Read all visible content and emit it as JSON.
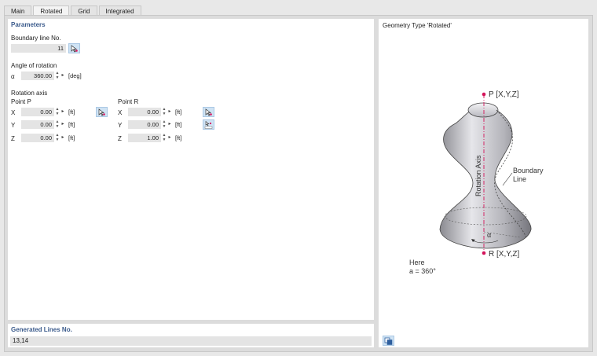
{
  "tabs": [
    "Main",
    "Rotated",
    "Grid",
    "Integrated"
  ],
  "active_tab": "Rotated",
  "parameters": {
    "title": "Parameters",
    "boundary_line_label": "Boundary line No.",
    "boundary_line_value": "11",
    "angle_label": "Angle of rotation",
    "alpha_symbol": "α",
    "alpha_value": "360.00",
    "alpha_unit": "[deg]",
    "rotation_axis_label": "Rotation axis",
    "point_p": {
      "label": "Point P",
      "x_label": "X",
      "x_value": "0.00",
      "y_label": "Y",
      "y_value": "0.00",
      "z_label": "Z",
      "z_value": "0.00",
      "unit": "[ft]"
    },
    "point_r": {
      "label": "Point R",
      "x_label": "X",
      "x_value": "0.00",
      "y_label": "Y",
      "y_value": "0.00",
      "z_label": "Z",
      "z_value": "1.00",
      "unit": "[ft]"
    }
  },
  "generated": {
    "title": "Generated Lines No.",
    "value": "13,14"
  },
  "diagram": {
    "title": "Geometry Type 'Rotated'",
    "p_label": "P [X,Y,Z]",
    "r_label": "R [X,Y,Z]",
    "axis_label": "Rotation Axis",
    "boundary_line1": "Boundary",
    "boundary_line2": "Line",
    "alpha_symbol": "α",
    "note_line1": "Here",
    "note_line2": "a = 360°"
  },
  "colors": {
    "section_title": "#3b5b8c",
    "axis": "#d4145a",
    "button": "#cfe3f4"
  }
}
